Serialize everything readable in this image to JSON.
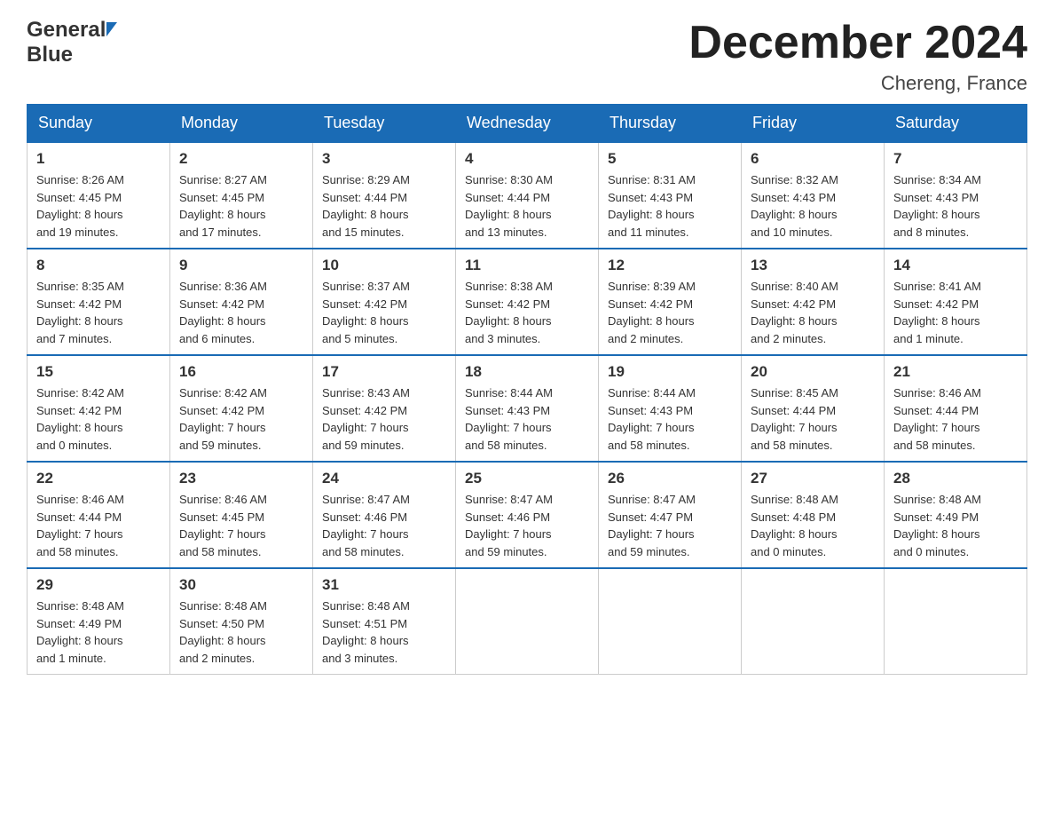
{
  "header": {
    "logo_line1": "General",
    "logo_line2": "Blue",
    "month_title": "December 2024",
    "location": "Chereng, France"
  },
  "days_of_week": [
    "Sunday",
    "Monday",
    "Tuesday",
    "Wednesday",
    "Thursday",
    "Friday",
    "Saturday"
  ],
  "weeks": [
    [
      {
        "day": "1",
        "info": "Sunrise: 8:26 AM\nSunset: 4:45 PM\nDaylight: 8 hours\nand 19 minutes."
      },
      {
        "day": "2",
        "info": "Sunrise: 8:27 AM\nSunset: 4:45 PM\nDaylight: 8 hours\nand 17 minutes."
      },
      {
        "day": "3",
        "info": "Sunrise: 8:29 AM\nSunset: 4:44 PM\nDaylight: 8 hours\nand 15 minutes."
      },
      {
        "day": "4",
        "info": "Sunrise: 8:30 AM\nSunset: 4:44 PM\nDaylight: 8 hours\nand 13 minutes."
      },
      {
        "day": "5",
        "info": "Sunrise: 8:31 AM\nSunset: 4:43 PM\nDaylight: 8 hours\nand 11 minutes."
      },
      {
        "day": "6",
        "info": "Sunrise: 8:32 AM\nSunset: 4:43 PM\nDaylight: 8 hours\nand 10 minutes."
      },
      {
        "day": "7",
        "info": "Sunrise: 8:34 AM\nSunset: 4:43 PM\nDaylight: 8 hours\nand 8 minutes."
      }
    ],
    [
      {
        "day": "8",
        "info": "Sunrise: 8:35 AM\nSunset: 4:42 PM\nDaylight: 8 hours\nand 7 minutes."
      },
      {
        "day": "9",
        "info": "Sunrise: 8:36 AM\nSunset: 4:42 PM\nDaylight: 8 hours\nand 6 minutes."
      },
      {
        "day": "10",
        "info": "Sunrise: 8:37 AM\nSunset: 4:42 PM\nDaylight: 8 hours\nand 5 minutes."
      },
      {
        "day": "11",
        "info": "Sunrise: 8:38 AM\nSunset: 4:42 PM\nDaylight: 8 hours\nand 3 minutes."
      },
      {
        "day": "12",
        "info": "Sunrise: 8:39 AM\nSunset: 4:42 PM\nDaylight: 8 hours\nand 2 minutes."
      },
      {
        "day": "13",
        "info": "Sunrise: 8:40 AM\nSunset: 4:42 PM\nDaylight: 8 hours\nand 2 minutes."
      },
      {
        "day": "14",
        "info": "Sunrise: 8:41 AM\nSunset: 4:42 PM\nDaylight: 8 hours\nand 1 minute."
      }
    ],
    [
      {
        "day": "15",
        "info": "Sunrise: 8:42 AM\nSunset: 4:42 PM\nDaylight: 8 hours\nand 0 minutes."
      },
      {
        "day": "16",
        "info": "Sunrise: 8:42 AM\nSunset: 4:42 PM\nDaylight: 7 hours\nand 59 minutes."
      },
      {
        "day": "17",
        "info": "Sunrise: 8:43 AM\nSunset: 4:42 PM\nDaylight: 7 hours\nand 59 minutes."
      },
      {
        "day": "18",
        "info": "Sunrise: 8:44 AM\nSunset: 4:43 PM\nDaylight: 7 hours\nand 58 minutes."
      },
      {
        "day": "19",
        "info": "Sunrise: 8:44 AM\nSunset: 4:43 PM\nDaylight: 7 hours\nand 58 minutes."
      },
      {
        "day": "20",
        "info": "Sunrise: 8:45 AM\nSunset: 4:44 PM\nDaylight: 7 hours\nand 58 minutes."
      },
      {
        "day": "21",
        "info": "Sunrise: 8:46 AM\nSunset: 4:44 PM\nDaylight: 7 hours\nand 58 minutes."
      }
    ],
    [
      {
        "day": "22",
        "info": "Sunrise: 8:46 AM\nSunset: 4:44 PM\nDaylight: 7 hours\nand 58 minutes."
      },
      {
        "day": "23",
        "info": "Sunrise: 8:46 AM\nSunset: 4:45 PM\nDaylight: 7 hours\nand 58 minutes."
      },
      {
        "day": "24",
        "info": "Sunrise: 8:47 AM\nSunset: 4:46 PM\nDaylight: 7 hours\nand 58 minutes."
      },
      {
        "day": "25",
        "info": "Sunrise: 8:47 AM\nSunset: 4:46 PM\nDaylight: 7 hours\nand 59 minutes."
      },
      {
        "day": "26",
        "info": "Sunrise: 8:47 AM\nSunset: 4:47 PM\nDaylight: 7 hours\nand 59 minutes."
      },
      {
        "day": "27",
        "info": "Sunrise: 8:48 AM\nSunset: 4:48 PM\nDaylight: 8 hours\nand 0 minutes."
      },
      {
        "day": "28",
        "info": "Sunrise: 8:48 AM\nSunset: 4:49 PM\nDaylight: 8 hours\nand 0 minutes."
      }
    ],
    [
      {
        "day": "29",
        "info": "Sunrise: 8:48 AM\nSunset: 4:49 PM\nDaylight: 8 hours\nand 1 minute."
      },
      {
        "day": "30",
        "info": "Sunrise: 8:48 AM\nSunset: 4:50 PM\nDaylight: 8 hours\nand 2 minutes."
      },
      {
        "day": "31",
        "info": "Sunrise: 8:48 AM\nSunset: 4:51 PM\nDaylight: 8 hours\nand 3 minutes."
      },
      {
        "day": "",
        "info": ""
      },
      {
        "day": "",
        "info": ""
      },
      {
        "day": "",
        "info": ""
      },
      {
        "day": "",
        "info": ""
      }
    ]
  ]
}
